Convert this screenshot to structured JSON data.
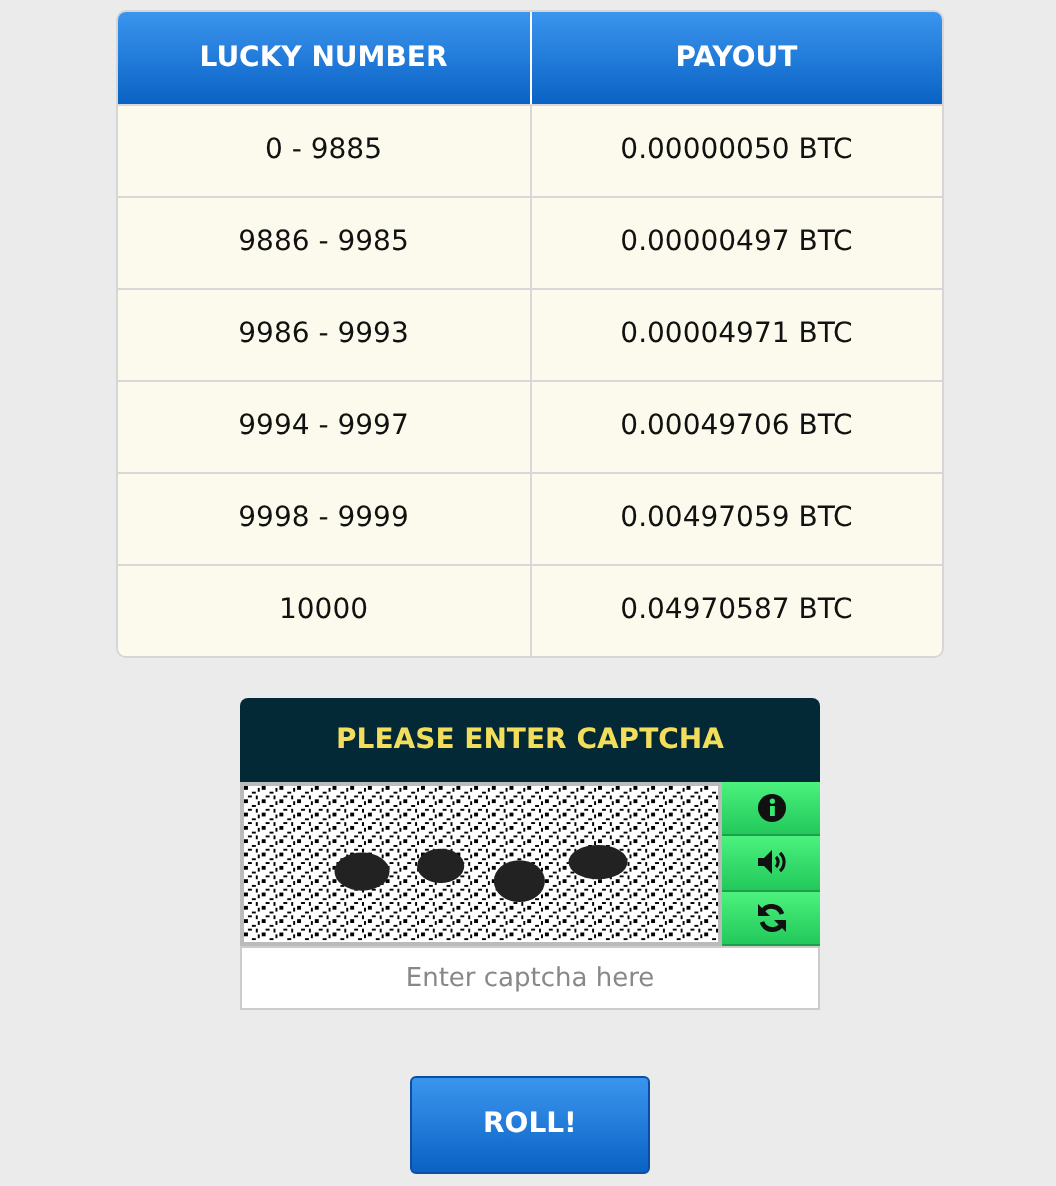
{
  "table": {
    "columns": [
      "LUCKY NUMBER",
      "PAYOUT"
    ],
    "rows": [
      [
        "0 - 9885",
        "0.00000050 BTC"
      ],
      [
        "9886 - 9985",
        "0.00000497 BTC"
      ],
      [
        "9986 - 9993",
        "0.00004971 BTC"
      ],
      [
        "9994 - 9997",
        "0.00049706 BTC"
      ],
      [
        "9998 - 9999",
        "0.00497059 BTC"
      ],
      [
        "10000",
        "0.04970587 BTC"
      ]
    ]
  },
  "captcha": {
    "title": "PLEASE ENTER CAPTCHA",
    "buttons": [
      {
        "kind": "info"
      },
      {
        "kind": "audio"
      },
      {
        "kind": "refresh"
      }
    ],
    "placeholder": "Enter captcha here"
  },
  "roll_button": "ROLL!"
}
